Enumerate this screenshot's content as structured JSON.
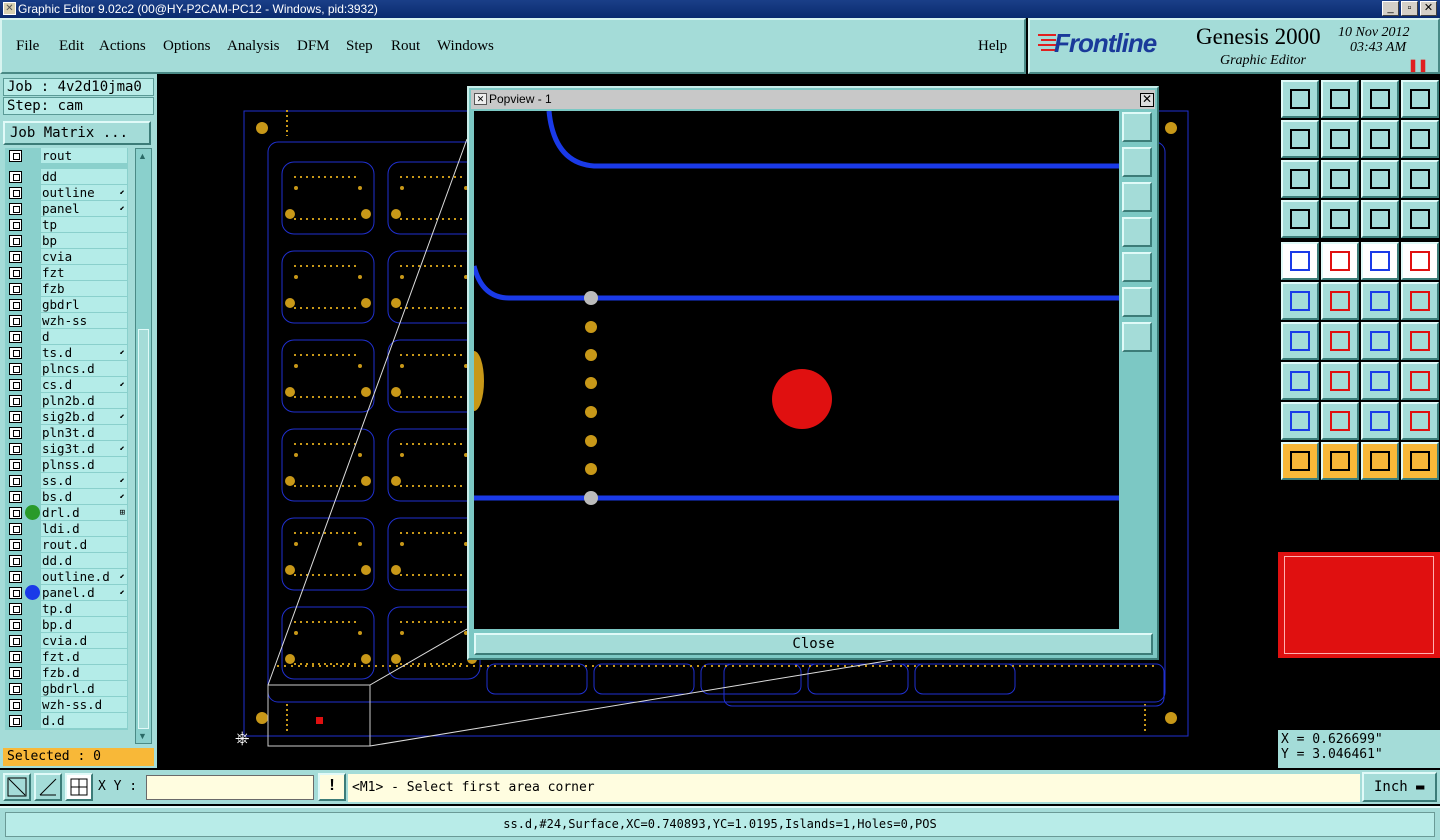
{
  "window": {
    "title": "Graphic Editor 9.02c2 (00@HY-P2CAM-PC12 - Windows, pid:3932)"
  },
  "menu": {
    "items": [
      "File",
      "Edit",
      "Actions",
      "Options",
      "Analysis",
      "DFM",
      "Step",
      "Rout",
      "Windows"
    ],
    "help": "Help"
  },
  "brand": {
    "logo": "Frontline",
    "product": "Genesis 2000",
    "subtitle": "Graphic Editor",
    "date": "10 Nov 2012",
    "time": "03:43 AM"
  },
  "job": {
    "job_label": "Job : 4v2d10jma0",
    "step_label": "Step: cam",
    "matrix_button": "Job Matrix ..."
  },
  "layers": [
    {
      "name": "rout",
      "dot": "",
      "mark": ""
    },
    {
      "name": "dd",
      "dot": "",
      "mark": ""
    },
    {
      "name": "outline",
      "dot": "",
      "mark": "⬋"
    },
    {
      "name": "panel",
      "dot": "",
      "mark": "⬋"
    },
    {
      "name": "tp",
      "dot": "",
      "mark": ""
    },
    {
      "name": "bp",
      "dot": "",
      "mark": ""
    },
    {
      "name": "cvia",
      "dot": "",
      "mark": ""
    },
    {
      "name": "fzt",
      "dot": "",
      "mark": ""
    },
    {
      "name": "fzb",
      "dot": "",
      "mark": ""
    },
    {
      "name": "gbdrl",
      "dot": "",
      "mark": ""
    },
    {
      "name": "wzh-ss",
      "dot": "",
      "mark": ""
    },
    {
      "name": "d",
      "dot": "",
      "mark": ""
    },
    {
      "name": "ts.d",
      "dot": "",
      "mark": "⬋"
    },
    {
      "name": "plncs.d",
      "dot": "",
      "mark": ""
    },
    {
      "name": "cs.d",
      "dot": "",
      "mark": "⬋"
    },
    {
      "name": "pln2b.d",
      "dot": "",
      "mark": ""
    },
    {
      "name": "sig2b.d",
      "dot": "",
      "mark": "⬋"
    },
    {
      "name": "pln3t.d",
      "dot": "",
      "mark": ""
    },
    {
      "name": "sig3t.d",
      "dot": "",
      "mark": "⬋"
    },
    {
      "name": "plnss.d",
      "dot": "",
      "mark": ""
    },
    {
      "name": "ss.d",
      "dot": "",
      "mark": "⬋"
    },
    {
      "name": "bs.d",
      "dot": "",
      "mark": "⬋"
    },
    {
      "name": "drl.d",
      "dot": "#2a9a2a",
      "mark": "⊞"
    },
    {
      "name": "ldi.d",
      "dot": "",
      "mark": ""
    },
    {
      "name": "rout.d",
      "dot": "",
      "mark": ""
    },
    {
      "name": "dd.d",
      "dot": "",
      "mark": ""
    },
    {
      "name": "outline.d",
      "dot": "",
      "mark": "⬋"
    },
    {
      "name": "panel.d",
      "dot": "#1a3ae8",
      "mark": "⬋"
    },
    {
      "name": "tp.d",
      "dot": "",
      "mark": ""
    },
    {
      "name": "bp.d",
      "dot": "",
      "mark": ""
    },
    {
      "name": "cvia.d",
      "dot": "",
      "mark": ""
    },
    {
      "name": "fzt.d",
      "dot": "",
      "mark": ""
    },
    {
      "name": "fzb.d",
      "dot": "",
      "mark": ""
    },
    {
      "name": "gbdrl.d",
      "dot": "",
      "mark": ""
    },
    {
      "name": "wzh-ss.d",
      "dot": "",
      "mark": ""
    },
    {
      "name": "d.d",
      "dot": "",
      "mark": ""
    }
  ],
  "selected_label": "Selected : 0",
  "popview": {
    "title": "Popview - 1",
    "close_button": "Close"
  },
  "coords": {
    "x": "X = 0.626699\"",
    "y": "Y = 3.046461\""
  },
  "bottom": {
    "xy_label": "X Y :",
    "xy_value": "",
    "message": "<M1> - Select first area corner",
    "unit": "Inch"
  },
  "status": "ss.d,#24,Surface,XC=0.740893,YC=1.0195,Islands=1,Holes=0,POS",
  "colors": {
    "panel_teal": "#a4dcd8",
    "board_outline": "#2030d0",
    "pad_gold": "#c89818",
    "trace_blue": "#1a3ae8",
    "surface_red": "#e01010",
    "selected_orange": "#f8b838"
  }
}
